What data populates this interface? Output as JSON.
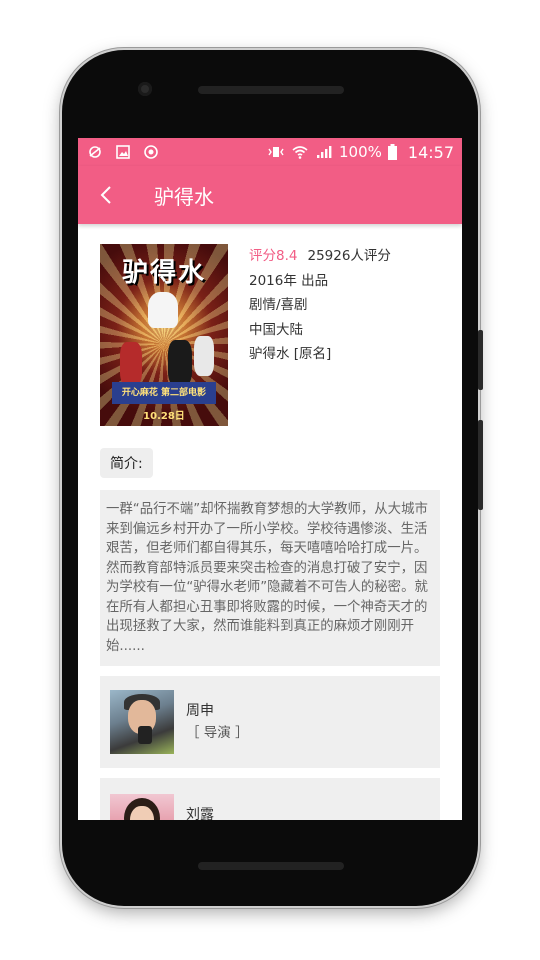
{
  "status_bar": {
    "left_icons": [
      "mute-icon",
      "image-icon",
      "sync-icon"
    ],
    "battery": "100%",
    "time": "14:57"
  },
  "app_bar": {
    "title": "驴得水",
    "back_icon": "chevron-left-icon"
  },
  "movie": {
    "rating_label": "评分8.4",
    "rating_count": "25926人评分",
    "year_line": "2016年  出品",
    "genre": "剧情/喜剧",
    "country": "中国大陆",
    "original_name": "驴得水 [原名]",
    "poster": {
      "title_art": "驴得水",
      "banner": "开心麻花 第二部电影",
      "date": "10.28日"
    }
  },
  "intro": {
    "label": "简介:",
    "text": "一群“品行不端”却怀揣教育梦想的大学教师，从大城市来到偏远乡村开办了一所小学校。学校待遇惨淡、生活艰苦，但老师们都自得其乐，每天嘻嘻哈哈打成一片。然而教育部特派员要来突击检查的消息打破了安宁，因为学校有一位“驴得水老师”隐藏着不可告人的秘密。就在所有人都担心丑事即将败露的时候，一个神奇天才的出现拯救了大家，然而谁能料到真正的麻烦才刚刚开始......"
  },
  "people": [
    {
      "name": "周申",
      "role": "［ 导演 ］"
    },
    {
      "name": "刘露",
      "role": ""
    }
  ],
  "colors": {
    "accent": "#f25d85",
    "panel": "#efefef"
  }
}
